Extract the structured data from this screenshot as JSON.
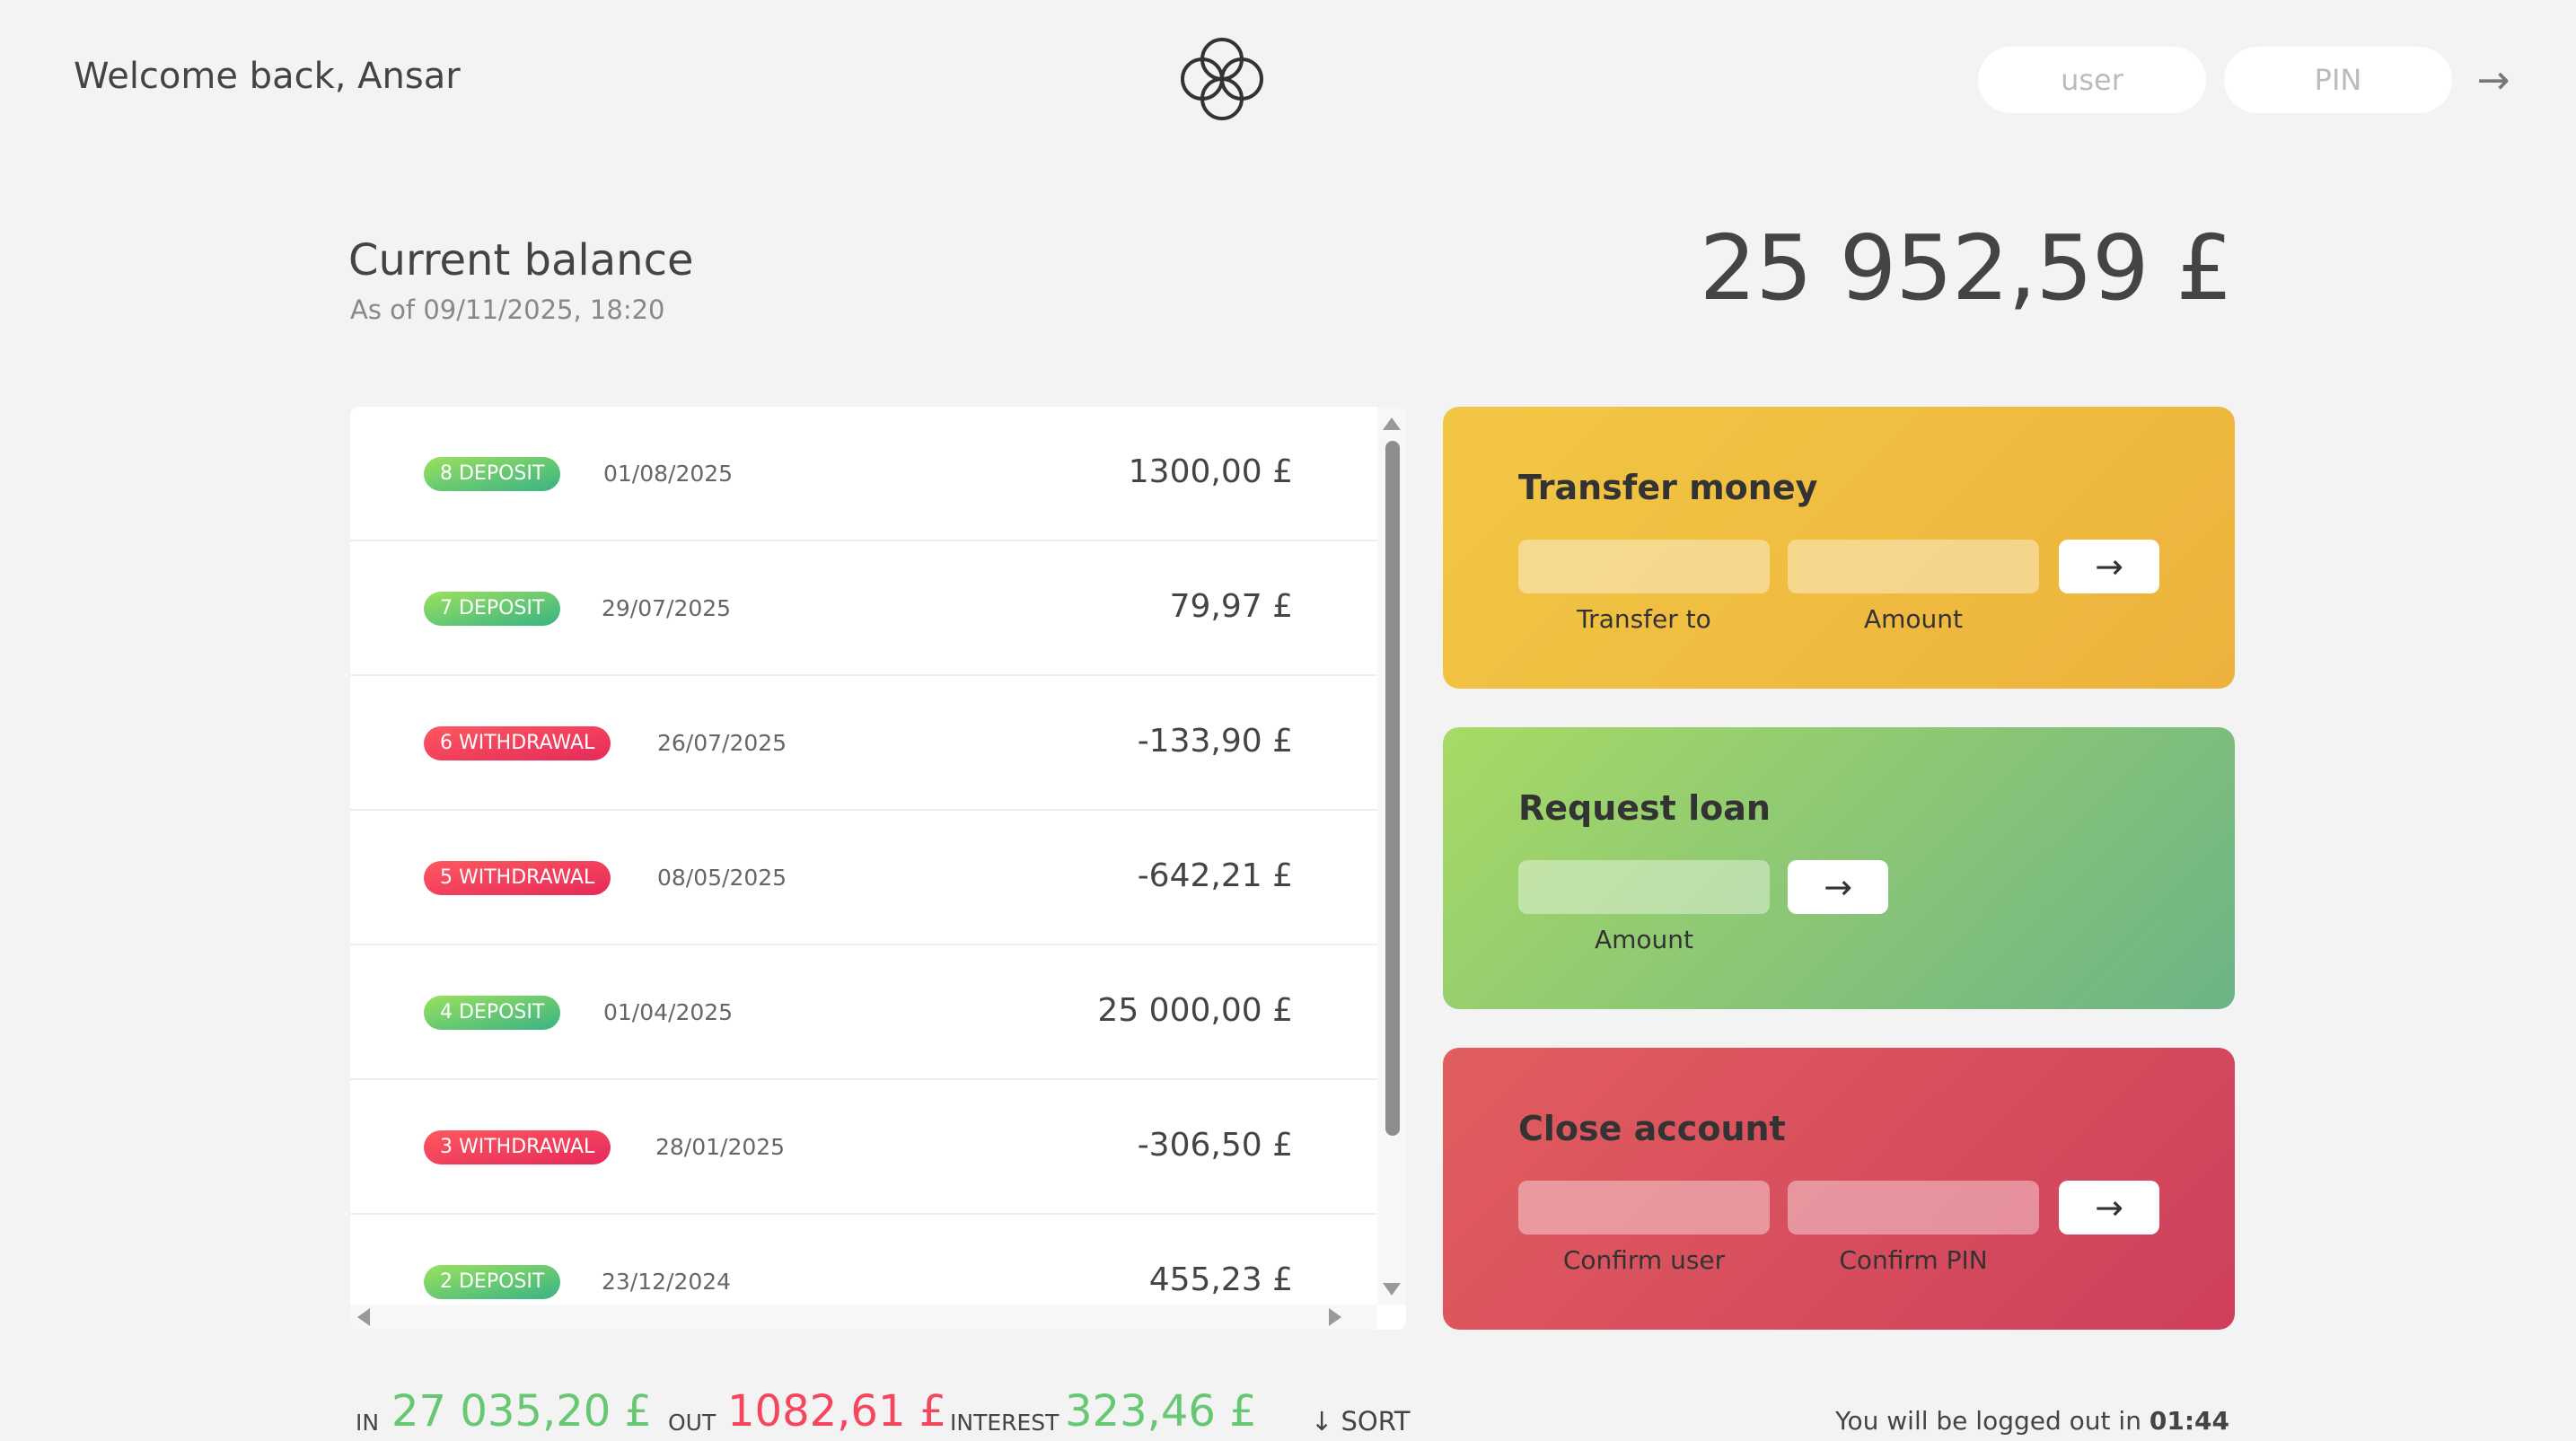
{
  "nav": {
    "welcome": "Welcome back, Ansar",
    "user_placeholder": "user",
    "pin_placeholder": "PIN",
    "login_button": "→"
  },
  "balance": {
    "label": "Current balance",
    "date": "As of 09/11/2025, 18:20",
    "value": "25 952,59 £"
  },
  "movements": [
    {
      "type": "deposit",
      "label": "8 DEPOSIT",
      "date": "01/08/2025",
      "value": "1300,00 £"
    },
    {
      "type": "deposit",
      "label": "7 DEPOSIT",
      "date": "29/07/2025",
      "value": "79,97 £"
    },
    {
      "type": "withdrawal",
      "label": "6 WITHDRAWAL",
      "date": "26/07/2025",
      "value": "-133,90 £"
    },
    {
      "type": "withdrawal",
      "label": "5 WITHDRAWAL",
      "date": "08/05/2025",
      "value": "-642,21 £"
    },
    {
      "type": "deposit",
      "label": "4 DEPOSIT",
      "date": "01/04/2025",
      "value": "25 000,00 £"
    },
    {
      "type": "withdrawal",
      "label": "3 WITHDRAWAL",
      "date": "28/01/2025",
      "value": "-306,50 £"
    },
    {
      "type": "deposit",
      "label": "2 DEPOSIT",
      "date": "23/12/2024",
      "value": "455,23 £"
    }
  ],
  "summary": {
    "in_label": "IN",
    "in_value": "27 035,20 £",
    "out_label": "OUT",
    "out_value": "1082,61 £",
    "interest_label": "INTEREST",
    "interest_value": "323,46 £",
    "sort_label": "↓ SORT"
  },
  "operations": {
    "transfer": {
      "title": "Transfer money",
      "to_label": "Transfer to",
      "amount_label": "Amount",
      "button": "→"
    },
    "loan": {
      "title": "Request loan",
      "amount_label": "Amount",
      "button": "→"
    },
    "close": {
      "title": "Close account",
      "user_label": "Confirm user",
      "pin_label": "Confirm PIN",
      "button": "→"
    }
  },
  "logout": {
    "prefix": "You will be logged out in ",
    "time": "01:44"
  },
  "colors": {
    "deposit": "#66c873",
    "withdrawal": "#f5465d",
    "transfer_card": "#f0bd40",
    "loan_card": "#8cc874",
    "close_card": "#d84d5d"
  }
}
